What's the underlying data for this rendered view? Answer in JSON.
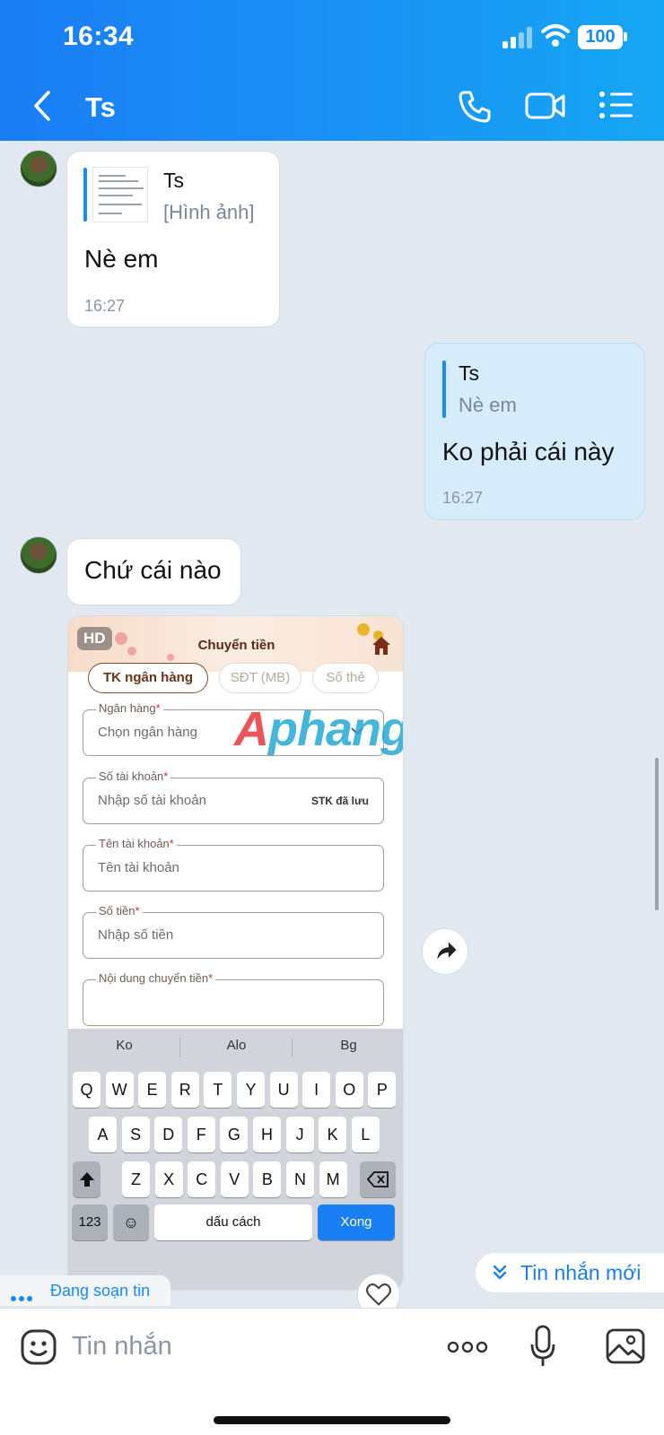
{
  "status_bar": {
    "time": "16:34",
    "battery": "100"
  },
  "header": {
    "title": "Ts",
    "icons": [
      "back-icon",
      "phone-icon",
      "video-call-icon",
      "menu-list-icon"
    ]
  },
  "messages": [
    {
      "from": "other",
      "quote": {
        "name": "Ts",
        "text": "[Hình ảnh]"
      },
      "text": "Nè em",
      "time": "16:27"
    },
    {
      "from": "me",
      "quote": {
        "name": "Ts",
        "text": "Nè em"
      },
      "text": "Ko phải cái này",
      "time": "16:27"
    },
    {
      "from": "other",
      "text": "Chứ cái nào"
    }
  ],
  "shared_image": {
    "badge": "HD",
    "title": "Chuyển tiền",
    "tabs": [
      "TK ngân hàng",
      "SĐT (MB)",
      "Số thẻ"
    ],
    "active_tab": "TK ngân hàng",
    "fields": [
      {
        "label": "Ngân hàng",
        "placeholder": "Chọn ngân hàng"
      },
      {
        "label": "Số tài khoản",
        "placeholder": "Nhập số tài khoản",
        "extra": "STK đã lưu"
      },
      {
        "label": "Tên tài khoản",
        "placeholder": "Tên tài khoản"
      },
      {
        "label": "Số tiền",
        "placeholder": "Nhập số tiền"
      },
      {
        "label": "Nội dung chuyển tiền",
        "placeholder": ""
      }
    ],
    "required_mark": "*",
    "watermark": {
      "part1": "A",
      "part2": "phang"
    },
    "keyboard": {
      "suggestions": [
        "Ko",
        "Alo",
        "Bg"
      ],
      "row1": [
        "Q",
        "W",
        "E",
        "R",
        "T",
        "Y",
        "U",
        "I",
        "O",
        "P"
      ],
      "row2": [
        "A",
        "S",
        "D",
        "F",
        "G",
        "H",
        "J",
        "K",
        "L"
      ],
      "row3": [
        "Z",
        "X",
        "C",
        "V",
        "B",
        "N",
        "M"
      ],
      "numbers_key": "123",
      "space_key": "dấu cách",
      "done_key": "Xong"
    }
  },
  "typing_indicator": "Đang soạn tin",
  "new_messages_button": "Tin nhắn mới",
  "composer": {
    "placeholder": "Tin nhắn"
  },
  "colors": {
    "header": "#1a8af5",
    "my_bubble": "#d6ecfb",
    "accent": "#1a7df5"
  }
}
